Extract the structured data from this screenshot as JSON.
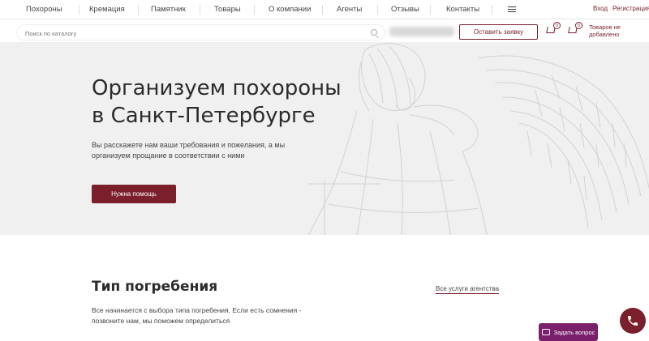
{
  "nav": {
    "items": [
      "Похороны",
      "Кремация",
      "Памятник",
      "Товары",
      "О компании",
      "Агенты",
      "Отзывы",
      "Контакты"
    ],
    "login": "Вход",
    "register": "Регистрация"
  },
  "search": {
    "placeholder": "Поиск по каталогу"
  },
  "header": {
    "request_button": "Оставить заявку",
    "compare_count": "0",
    "cart_count": "0",
    "cart_label": "Товаров не добавлено"
  },
  "hero": {
    "title_line1": "Организуем похороны",
    "title_line2": "в Санкт-Петербурге",
    "subtitle": "Вы расскажете нам ваши требования и пожелания, а мы организуем прощание в соответствии с ними",
    "button": "Нужна помощь"
  },
  "section": {
    "title": "Тип погребения",
    "link": "Все услуги агентства",
    "text": "Все начинается с выбора типа погребения. Если есть сомнения - позвоните нам, мы поможем определиться"
  },
  "floating": {
    "ask_button": "Задать вопрос"
  },
  "colors": {
    "accent": "#7a1f2b",
    "ask_accent": "#7a1f6b",
    "hero_bg": "#f0f0f0"
  }
}
